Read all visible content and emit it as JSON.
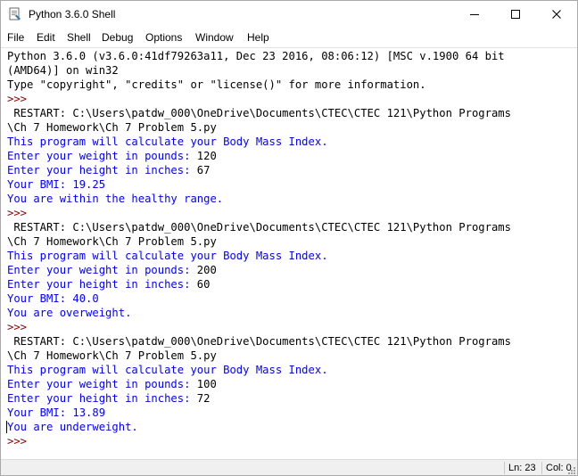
{
  "window": {
    "title": "Python 3.6.0 Shell",
    "icon": "python-idle-icon",
    "controls": {
      "minimize_icon": "minimize-icon",
      "maximize_icon": "maximize-icon",
      "close_icon": "close-icon"
    }
  },
  "menu": [
    "File",
    "Edit",
    "Shell",
    "Debug",
    "Options",
    "Window",
    "Help"
  ],
  "colors": {
    "output": "#0000ff",
    "prompt": "#8b0000",
    "stdout_text": "#000000",
    "statusbar_bg": "#f0f0f0"
  },
  "shell": {
    "lines": [
      {
        "type": "normal",
        "text": "Python 3.6.0 (v3.6.0:41df79263a11, Dec 23 2016, 08:06:12) [MSC v.1900 64 bit"
      },
      {
        "type": "normal",
        "text": "(AMD64)] on win32"
      },
      {
        "type": "normal",
        "text": "Type \"copyright\", \"credits\" or \"license()\" for more information."
      },
      {
        "type": "prompt",
        "text": ">>> "
      },
      {
        "type": "normal",
        "text": " RESTART: C:\\Users\\patdw_000\\OneDrive\\Documents\\CTEC\\CTEC 121\\Python Programs"
      },
      {
        "type": "normal",
        "text": "\\Ch 7 Homework\\Ch 7 Problem 5.py"
      },
      {
        "type": "output",
        "text": "This program will calculate your Body Mass Index."
      },
      {
        "type": "output",
        "text": "Enter your weight in pounds: ",
        "input": "120"
      },
      {
        "type": "output",
        "text": "Enter your height in inches: ",
        "input": "67"
      },
      {
        "type": "output",
        "text": "Your BMI: 19.25"
      },
      {
        "type": "output",
        "text": "You are within the healthy range."
      },
      {
        "type": "prompt",
        "text": ">>> "
      },
      {
        "type": "normal",
        "text": " RESTART: C:\\Users\\patdw_000\\OneDrive\\Documents\\CTEC\\CTEC 121\\Python Programs"
      },
      {
        "type": "normal",
        "text": "\\Ch 7 Homework\\Ch 7 Problem 5.py"
      },
      {
        "type": "output",
        "text": "This program will calculate your Body Mass Index."
      },
      {
        "type": "output",
        "text": "Enter your weight in pounds: ",
        "input": "200"
      },
      {
        "type": "output",
        "text": "Enter your height in inches: ",
        "input": "60"
      },
      {
        "type": "output",
        "text": "Your BMI: 40.0"
      },
      {
        "type": "output",
        "text": "You are overweight."
      },
      {
        "type": "prompt",
        "text": ">>> "
      },
      {
        "type": "normal",
        "text": " RESTART: C:\\Users\\patdw_000\\OneDrive\\Documents\\CTEC\\CTEC 121\\Python Programs"
      },
      {
        "type": "normal",
        "text": "\\Ch 7 Homework\\Ch 7 Problem 5.py"
      },
      {
        "type": "output",
        "text": "This program will calculate your Body Mass Index."
      },
      {
        "type": "output",
        "text": "Enter your weight in pounds: ",
        "input": "100"
      },
      {
        "type": "output",
        "text": "Enter your height in inches: ",
        "input": "72"
      },
      {
        "type": "output",
        "text": "Your BMI: 13.89"
      },
      {
        "type": "output",
        "text": "You are underweight.",
        "caret": true
      },
      {
        "type": "prompt",
        "text": ">>> "
      }
    ]
  },
  "status": {
    "line": "Ln: 23",
    "col": "Col: 0"
  }
}
